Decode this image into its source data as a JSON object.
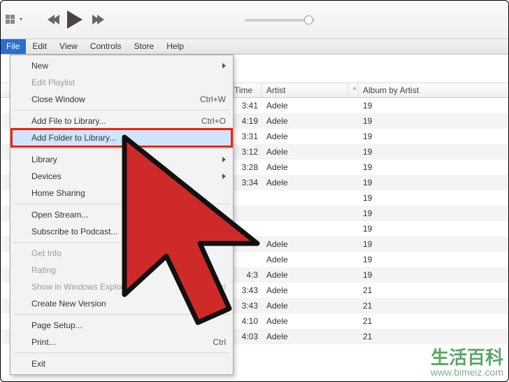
{
  "toolbar": {
    "mini_grid_tooltip": "View",
    "play_state": "paused"
  },
  "menubar": {
    "items": [
      "File",
      "Edit",
      "View",
      "Controls",
      "Store",
      "Help"
    ],
    "active_index": 0
  },
  "dropdown": {
    "groups": [
      [
        {
          "label": "New",
          "submenu": true
        },
        {
          "label": "Edit Playlist",
          "disabled": true
        },
        {
          "label": "Close Window",
          "shortcut": "Ctrl+W"
        }
      ],
      [
        {
          "label": "Add File to Library...",
          "shortcut": "Ctrl+O"
        },
        {
          "label": "Add Folder to Library...",
          "highlight": true
        }
      ],
      [
        {
          "label": "Library",
          "submenu": true
        },
        {
          "label": "Devices",
          "submenu": true
        },
        {
          "label": "Home Sharing"
        }
      ],
      [
        {
          "label": "Open Stream..."
        },
        {
          "label": "Subscribe to Podcast..."
        }
      ],
      [
        {
          "label": "Get Info",
          "disabled": true
        },
        {
          "label": "Rating",
          "disabled": true
        },
        {
          "label": "Show in Windows Explorer",
          "shortcut": "Ctrl",
          "disabled": true
        },
        {
          "label": "Create New Version"
        }
      ],
      [
        {
          "label": "Page Setup..."
        },
        {
          "label": "Print...",
          "shortcut": "Ctrl"
        }
      ],
      [
        {
          "label": "Exit"
        }
      ]
    ]
  },
  "table": {
    "columns": {
      "time": "Time",
      "artist": "Artist",
      "album": "Album by Artist",
      "sort_indicator": "^"
    },
    "rows": [
      {
        "time": "3:41",
        "artist": "Adele",
        "album": "19"
      },
      {
        "time": "4:19",
        "artist": "Adele",
        "album": "19"
      },
      {
        "time": "3:31",
        "artist": "Adele",
        "album": "19"
      },
      {
        "time": "3:12",
        "artist": "Adele",
        "album": "19"
      },
      {
        "time": "3:28",
        "artist": "Adele",
        "album": "19"
      },
      {
        "time": "3:34",
        "artist": "Adele",
        "album": "19"
      },
      {
        "time": "",
        "artist": "",
        "album": "19"
      },
      {
        "time": "",
        "artist": "",
        "album": "19"
      },
      {
        "time": "",
        "artist": "",
        "album": "19"
      },
      {
        "time": "",
        "artist": "Adele",
        "album": "19"
      },
      {
        "time": "",
        "artist": "Adele",
        "album": "19"
      },
      {
        "time": "4:3",
        "artist": "Adele",
        "album": "19"
      },
      {
        "time": "3:43",
        "artist": "Adele",
        "album": "21"
      },
      {
        "time": "3:43",
        "artist": "Adele",
        "album": "21"
      },
      {
        "time": "4:10",
        "artist": "Adele",
        "album": "21"
      },
      {
        "time": "4:03",
        "artist": "Adele",
        "album": "21"
      }
    ]
  },
  "watermark": {
    "text": "生活百科",
    "url": "www.bimeiz.com"
  }
}
